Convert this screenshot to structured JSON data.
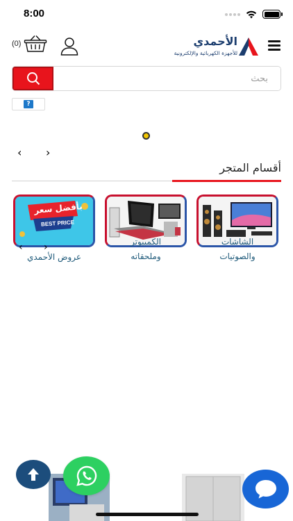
{
  "status_bar": {
    "time": "8:00"
  },
  "header": {
    "cart_count": "(0)",
    "logo_title": "الأحمدي",
    "logo_subtitle": "للأجهزة الكهربائية والإلكترونية"
  },
  "search": {
    "placeholder": "بحث"
  },
  "section": {
    "title": "أقسام المتجر"
  },
  "categories": [
    {
      "label_line1": "الشاشات",
      "label_line2": "والصوتيات",
      "icon": "tv-speakers-image"
    },
    {
      "label_line1": "الكمبيوتر",
      "label_line2": "وملحقاته",
      "icon": "computer-image"
    },
    {
      "label_line1": "عروض الأحمدي",
      "label_line2": "",
      "icon": "best-price-image",
      "badge_ar": "بأفضل سعر",
      "badge_en": "BEST PRICE"
    }
  ],
  "nav_arrows": {
    "prev": "‹",
    "next": "›"
  },
  "colors": {
    "brand_red": "#e8141c",
    "brand_blue": "#1b3d6e",
    "whatsapp_green": "#2dd061",
    "chat_blue": "#1866d6"
  }
}
